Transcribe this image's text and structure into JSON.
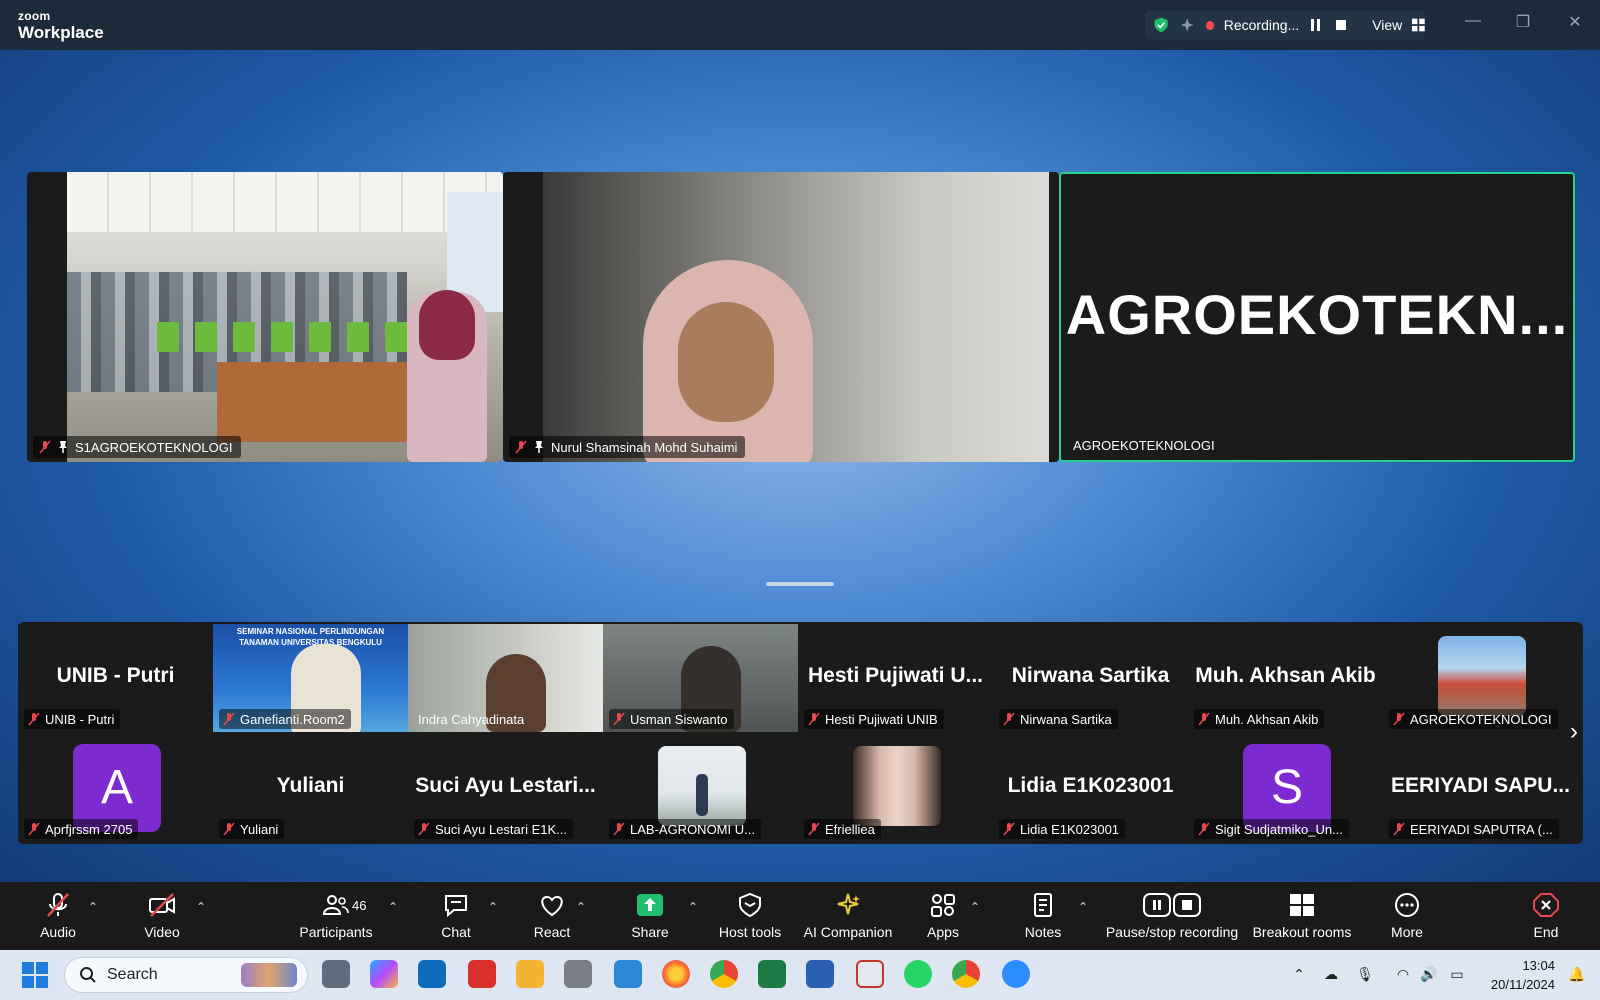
{
  "app": {
    "brand_small": "zoom",
    "brand_large": "Workplace"
  },
  "top_bar": {
    "recording_label": "Recording...",
    "view_label": "View"
  },
  "speakers": [
    {
      "name": "S1AGROEKOTEKNOLOGI"
    },
    {
      "name": "Nurul Shamsinah Mohd Suhaimi"
    },
    {
      "name": "AGROEKOTEKNOLOGI",
      "display_name": "AGROEKOTEKN..."
    }
  ],
  "gallery": {
    "row1": [
      {
        "title": "UNIB - Putri",
        "label": "UNIB - Putri"
      },
      {
        "title": "",
        "label": "Ganefianti.Room2",
        "banner": "SEMINAR NASIONAL PERLINDUNGAN TANAMAN UNIVERSITAS BENGKULU"
      },
      {
        "title": "",
        "label": "Indra Cahyadinata"
      },
      {
        "title": "",
        "label": "Usman Siswanto"
      },
      {
        "title": "Hesti Pujiwati U...",
        "label": "Hesti Pujiwati UNIB"
      },
      {
        "title": "Nirwana Sartika",
        "label": "Nirwana Sartika"
      },
      {
        "title": "Muh. Akhsan Akib",
        "label": "Muh. Akhsan Akib"
      },
      {
        "title": "",
        "label": "AGROEKOTEKNOLOGI"
      }
    ],
    "row2": [
      {
        "title": "",
        "avatar": "A",
        "label": "Aprfjrssm 2705"
      },
      {
        "title": "Yuliani",
        "label": "Yuliani"
      },
      {
        "title": "Suci Ayu Lestari...",
        "label": "Suci Ayu Lestari E1K..."
      },
      {
        "title": "",
        "label": "LAB-AGRONOMI U..."
      },
      {
        "title": "",
        "label": "Efrielliea"
      },
      {
        "title": "Lidia E1K023001",
        "label": "Lidia E1K023001"
      },
      {
        "title": "",
        "avatar": "S",
        "label": "Sigit Sudjatmiko_Un..."
      },
      {
        "title": "EERIYADI SAPU...",
        "label": "EERIYADI SAPUTRA (..."
      }
    ]
  },
  "toolbar": {
    "audio": "Audio",
    "video": "Video",
    "participants": "Participants",
    "participants_count": "46",
    "chat": "Chat",
    "react": "React",
    "share": "Share",
    "host_tools": "Host tools",
    "ai_companion": "AI Companion",
    "apps": "Apps",
    "notes": "Notes",
    "pause_recording": "Pause/stop recording",
    "breakout_rooms": "Breakout rooms",
    "more": "More",
    "end": "End"
  },
  "taskbar": {
    "search_placeholder": "Search",
    "time": "13:04",
    "date": "20/11/2024",
    "apps": [
      "task-view",
      "copilot",
      "outlook",
      "pdf-editor",
      "file-explorer",
      "printer",
      "notepad",
      "firefox",
      "chrome",
      "excel",
      "word",
      "snipping-tool",
      "whatsapp",
      "chrome-profile",
      "zoom"
    ]
  },
  "colors": {
    "active_speaker_border": "#23d18b",
    "share_green": "#1fbf6b",
    "end_red": "#e5484d",
    "avatar_purple": "#7d2bd1"
  }
}
